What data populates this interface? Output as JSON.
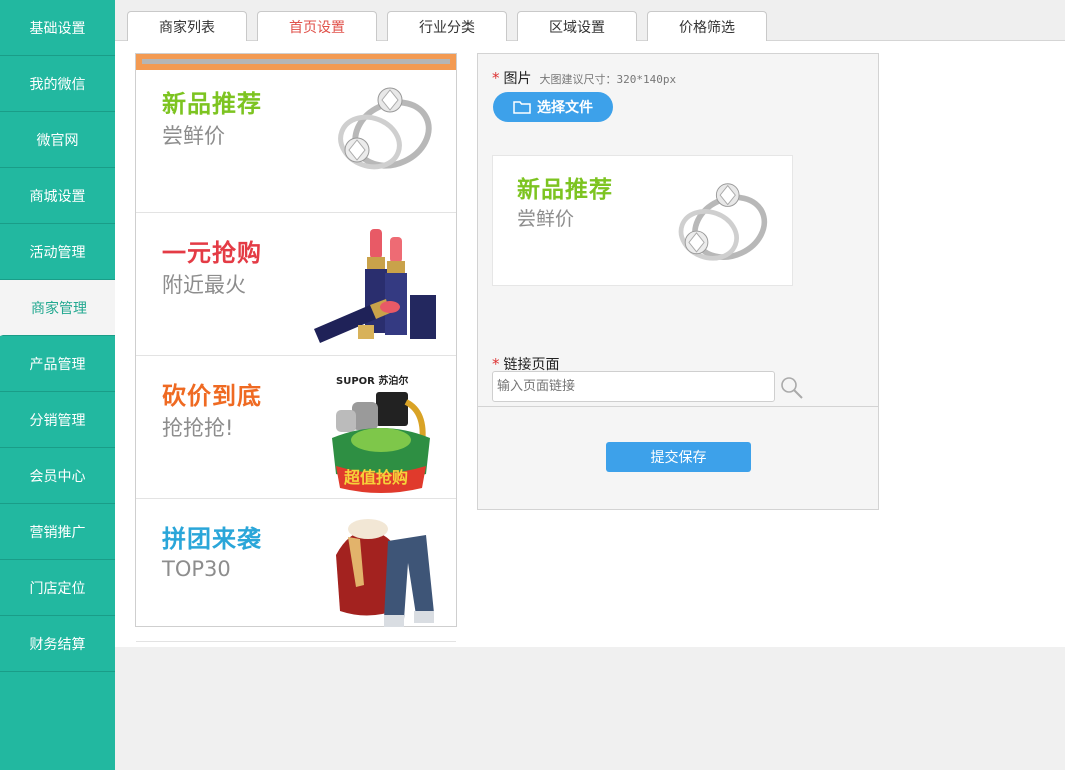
{
  "sidebar": {
    "items": [
      {
        "label": "基础设置"
      },
      {
        "label": "我的微信"
      },
      {
        "label": "微官网"
      },
      {
        "label": "商城设置"
      },
      {
        "label": "活动管理"
      },
      {
        "label": "商家管理"
      },
      {
        "label": "产品管理"
      },
      {
        "label": "分销管理"
      },
      {
        "label": "会员中心"
      },
      {
        "label": "营销推广"
      },
      {
        "label": "门店定位"
      },
      {
        "label": "财务结算"
      }
    ],
    "active_index": 5
  },
  "tabs": [
    {
      "label": "商家列表"
    },
    {
      "label": "首页设置"
    },
    {
      "label": "行业分类"
    },
    {
      "label": "区域设置"
    },
    {
      "label": "价格筛选"
    }
  ],
  "active_tab": 1,
  "preview": {
    "banners": [
      {
        "title": "新品推荐",
        "subtitle": "尝鲜价",
        "title_color": "#7dc421",
        "art": "ring-icon"
      },
      {
        "title": "一元抢购",
        "subtitle": "附近最火",
        "title_color": "#e43b45",
        "art": "lipstick-icon"
      },
      {
        "title": "砍价到底",
        "subtitle": "抢抢抢!",
        "title_color": "#ef6a22",
        "art": "appliance-promo-icon",
        "brand": "SUPOR 苏泊尔",
        "badge": "超值抢购"
      },
      {
        "title": "拼团来袭",
        "subtitle": "TOP30",
        "title_color": "#2aa6d9",
        "art": "clothes-icon"
      }
    ]
  },
  "form": {
    "image_label": "图片",
    "image_hint": "大图建议尺寸：320*140px",
    "choose_file": "选择文件",
    "image_preview": {
      "title": "新品推荐",
      "subtitle": "尝鲜价",
      "title_color": "#7dc421"
    },
    "link_label": "链接页面",
    "link_placeholder": "输入页面链接",
    "submit": "提交保存"
  },
  "colors": {
    "sidebar": "#22b8a0",
    "accent": "#3da1ea",
    "tab_active": "#e0524b",
    "required": "#dd3333"
  }
}
